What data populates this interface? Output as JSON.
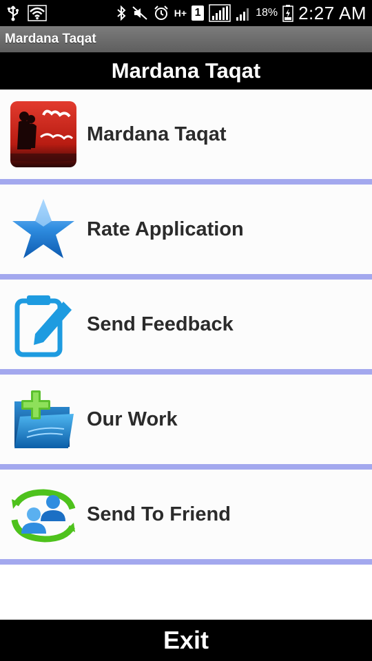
{
  "status_bar": {
    "battery_percent": "18%",
    "time": "2:27 AM",
    "network_label": "H+",
    "sim_label": "1"
  },
  "title_bar": {
    "title": "Mardana Taqat"
  },
  "header": {
    "title": "Mardana Taqat"
  },
  "menu": {
    "items": [
      {
        "label": "Mardana Taqat",
        "icon": "app-logo-icon"
      },
      {
        "label": "Rate Application",
        "icon": "star-icon"
      },
      {
        "label": "Send Feedback",
        "icon": "feedback-edit-icon"
      },
      {
        "label": "Our Work",
        "icon": "folder-add-icon"
      },
      {
        "label": "Send To Friend",
        "icon": "share-users-icon"
      }
    ]
  },
  "exit": {
    "label": "Exit"
  },
  "colors": {
    "divider": "#a3a8ee",
    "header_bg": "#000000",
    "title_bar_bg": "#6b6b6b",
    "item_text": "#2b2b2b"
  }
}
